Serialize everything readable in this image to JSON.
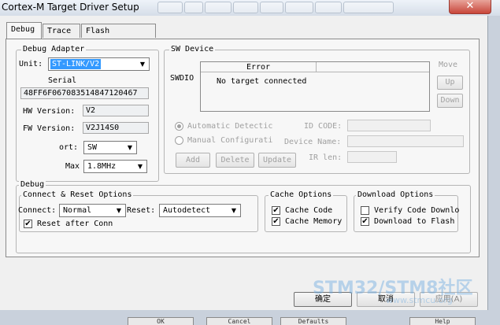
{
  "window": {
    "title": "Cortex-M Target Driver Setup",
    "close_glyph": "✕"
  },
  "tabs": [
    {
      "label": "Debug"
    },
    {
      "label": "Trace"
    },
    {
      "label": "Flash Download"
    }
  ],
  "debug_adapter": {
    "title": "Debug Adapter",
    "unit_label": "Unit:",
    "unit_value": "ST-LINK/V2",
    "serial_label": "Serial",
    "serial_value": "48FF6F067083514847120467",
    "hw_label": "HW Version:",
    "hw_value": "V2",
    "fw_label": "FW Version:",
    "fw_value": "V2J14S0",
    "port_label": "ort:",
    "port_value": "SW",
    "max_label": "Max",
    "max_value": "1.8MHz"
  },
  "sw_device": {
    "title": "SW Device",
    "swdio_label": "SWDIO",
    "col_error": "Error",
    "row_message": "No target connected",
    "move_label": "Move",
    "up_label": "Up",
    "down_label": "Down",
    "auto_detect_label": "Automatic Detectic",
    "manual_config_label": "Manual Configurati",
    "id_code_label": "ID CODE:",
    "device_name_label": "Device Name:",
    "ir_len_label": "IR len:",
    "add_label": "Add",
    "delete_label": "Delete",
    "update_label": "Update"
  },
  "debug_group": {
    "title": "Debug",
    "connect_reset": {
      "title": "Connect & Reset Options",
      "connect_label": "Connect:",
      "connect_value": "Normal",
      "reset_label": "Reset:",
      "reset_value": "Autodetect",
      "reset_after_conn_label": "Reset after Conn",
      "reset_after_conn_checked": true
    },
    "cache": {
      "title": "Cache Options",
      "cache_code_label": "Cache Code",
      "cache_code_checked": true,
      "cache_memory_label": "Cache Memory",
      "cache_memory_checked": true
    },
    "download": {
      "title": "Download Options",
      "verify_label": "Verify Code Downlo",
      "verify_checked": false,
      "download_flash_label": "Download to Flash",
      "download_flash_checked": true
    }
  },
  "buttons": {
    "ok": "确定",
    "cancel": "取消",
    "apply": "应用(A)"
  },
  "watermark": {
    "brand": "STM32/STM8社区",
    "url": "www.stmcu.org"
  },
  "background_window": {
    "buttons": [
      "OK",
      "Cancel",
      "Defaults",
      "Help"
    ]
  },
  "icons": {
    "check": "✔",
    "dropdown": "▼"
  }
}
